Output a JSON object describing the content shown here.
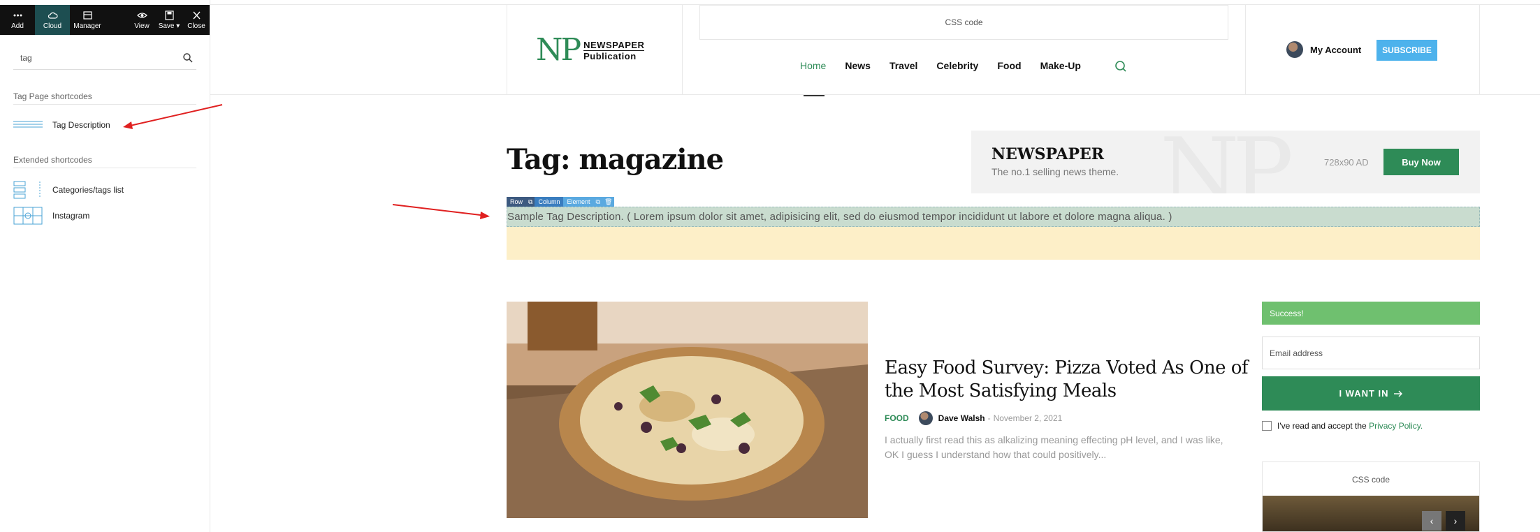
{
  "editor": {
    "toolbar": [
      {
        "label": "Add",
        "icon": "dots-icon"
      },
      {
        "label": "Cloud",
        "icon": "cloud-icon"
      },
      {
        "label": "Manager",
        "icon": "manager-icon"
      },
      {
        "label": "View",
        "icon": "eye-icon"
      },
      {
        "label": "Save",
        "icon": "save-icon"
      },
      {
        "label": "Close",
        "icon": "close-icon"
      }
    ],
    "search": {
      "value": "tag"
    },
    "sections": [
      {
        "title": "Tag Page shortcodes",
        "items": [
          {
            "label": "Tag Description"
          }
        ]
      },
      {
        "title": "Extended shortcodes",
        "items": [
          {
            "label": "Categories/tags list"
          },
          {
            "label": "Instagram"
          }
        ]
      }
    ],
    "element_toolbar": [
      "Row",
      "Column",
      "Element"
    ]
  },
  "header": {
    "logo_mark": "NP",
    "logo_line1": "NEWSPAPER",
    "logo_line2": "Publication",
    "css_code": "CSS code",
    "nav": [
      "Home",
      "News",
      "Travel",
      "Celebrity",
      "Food",
      "Make-Up"
    ],
    "account": "My Account",
    "subscribe": "SUBSCRIBE"
  },
  "main": {
    "tag_title": "Tag: magazine",
    "ad": {
      "watermark": "NP",
      "title": "NEWSPAPER",
      "subtitle": "The no.1 selling news theme.",
      "size": "728x90 AD",
      "button": "Buy Now"
    },
    "tag_description": "Sample Tag Description. ( Lorem ipsum dolor sit amet, adipisicing elit, sed do eiusmod tempor incididunt ut labore et dolore magna aliqua. )",
    "post": {
      "title": "Easy Food Survey: Pizza Voted As One of the Most Satisfying Meals",
      "category": "FOOD",
      "author": "Dave Walsh",
      "separator": "-",
      "date": "November 2, 2021",
      "excerpt": "I actually first read this as alkalizing meaning effecting pH level, and I was like, OK I guess I understand how that could positively..."
    }
  },
  "sidebar": {
    "success": "Success!",
    "email_placeholder": "Email address",
    "want_in": "I WANT IN",
    "privacy_text": "I've read and accept the",
    "privacy_link": "Privacy Policy.",
    "css_code": "CSS code"
  },
  "colors": {
    "accent": "#2e8b57",
    "subscribe": "#4db2ec",
    "success": "#6fc06f",
    "toolbar": "#111111",
    "active_tool": "#1d4e51",
    "arrow": "#e02020"
  }
}
